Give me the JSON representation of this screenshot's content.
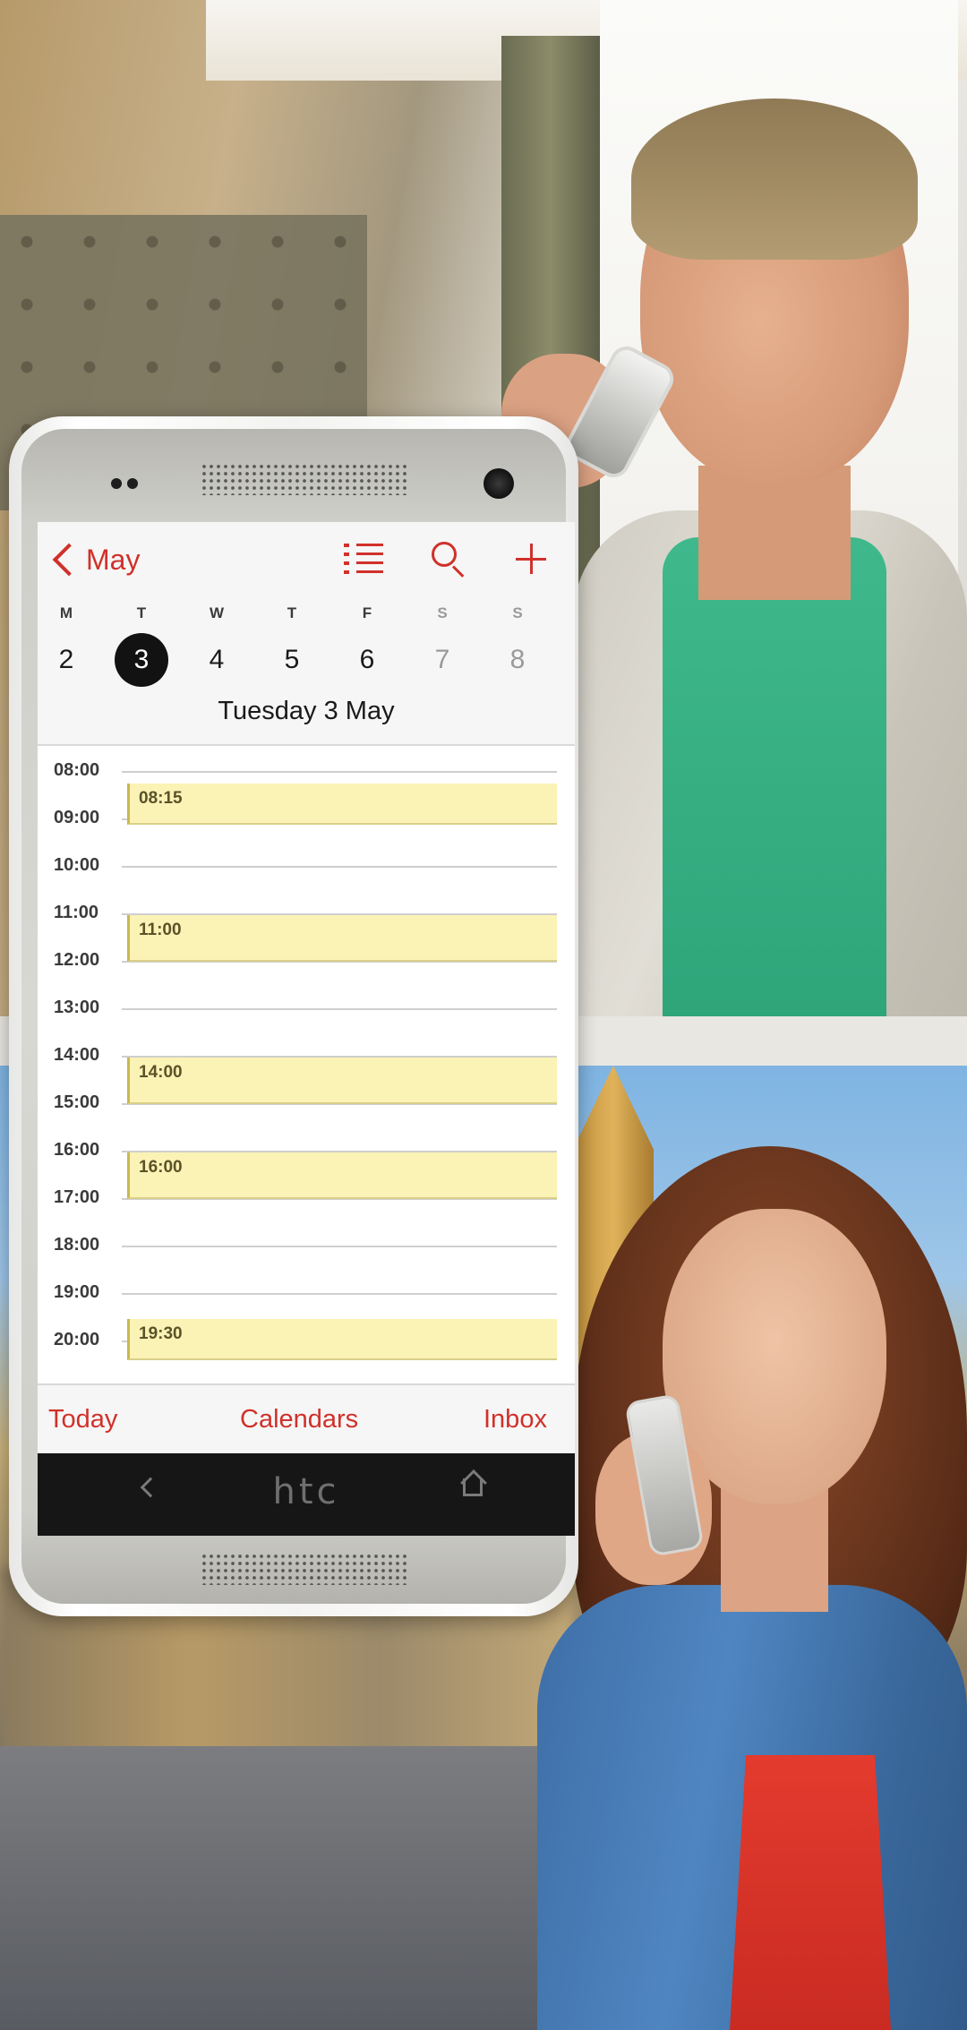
{
  "calendar": {
    "back_label": "May",
    "weekdays": [
      "M",
      "T",
      "W",
      "T",
      "F",
      "S",
      "S"
    ],
    "dates": [
      "2",
      "3",
      "4",
      "5",
      "6",
      "7",
      "8"
    ],
    "selected_index": 1,
    "date_title": "Tuesday 3 May",
    "hours": [
      "08:00",
      "09:00",
      "10:00",
      "11:00",
      "12:00",
      "13:00",
      "14:00",
      "15:00",
      "16:00",
      "17:00",
      "18:00",
      "19:00",
      "20:00"
    ],
    "events": [
      {
        "time": "08:15"
      },
      {
        "time": "11:00"
      },
      {
        "time": "14:00"
      },
      {
        "time": "16:00"
      },
      {
        "time": "19:30"
      }
    ],
    "footer": {
      "today": "Today",
      "calendars": "Calendars",
      "inbox": "Inbox"
    },
    "accent_color": "#d0312b",
    "event_color": "#fbf2b5"
  },
  "device": {
    "brand": "htc"
  }
}
